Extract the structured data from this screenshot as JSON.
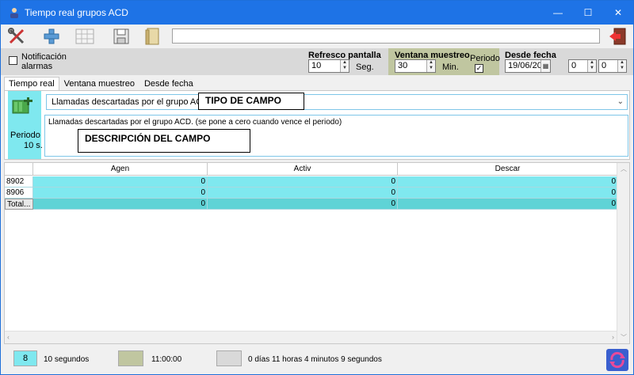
{
  "window": {
    "title": "Tiempo real grupos ACD",
    "minimize_glyph": "—",
    "maximize_glyph": "☐",
    "close_glyph": "✕"
  },
  "toolbar": {
    "buttons": [
      {
        "icon": "tools-icon"
      },
      {
        "icon": "plus-icon"
      },
      {
        "icon": "grid-icon"
      },
      {
        "icon": "save-icon"
      },
      {
        "icon": "book-icon"
      }
    ],
    "search_value": "",
    "exit_icon": "exit-icon"
  },
  "options": {
    "notificacion_label_1": "Notificación",
    "notificacion_label_2": "alarmas",
    "refresco_label": "Refresco pantalla",
    "refresco_value": "10",
    "refresco_unit": "Seg.",
    "ventana_label": "Ventana muestreo",
    "ventana_value": "30",
    "ventana_unit": "Min.",
    "periodo_label": "Periodo",
    "periodo_checked": true,
    "desde_label": "Desde fecha",
    "desde_value": "19/06/20",
    "hour_value": "0",
    "minute_value": "0"
  },
  "tabs": [
    {
      "label": "Tiempo real",
      "active": true
    },
    {
      "label": "Ventana muestreo",
      "active": false
    },
    {
      "label": "Desde fecha",
      "active": false
    }
  ],
  "panel": {
    "periodo_label": "Periodo",
    "periodo_value": "10 s.",
    "combo_value": "Llamadas descartadas por el grupo ACD",
    "description": "Llamadas descartadas por el grupo ACD. (se pone a cero cuando vence el periodo)",
    "callout_tipo": "TIPO DE CAMPO",
    "callout_desc": "DESCRIPCIÓN DEL CAMPO"
  },
  "grid": {
    "columns": [
      "Agen",
      "Activ",
      "Descar"
    ],
    "rows": [
      {
        "label": "8902",
        "values": [
          "0",
          "0",
          "0"
        ]
      },
      {
        "label": "8906",
        "values": [
          "0",
          "0",
          "0"
        ]
      },
      {
        "label": "Total...",
        "values": [
          "0",
          "0",
          "0"
        ],
        "total": true
      }
    ]
  },
  "status": {
    "box1_value": "8",
    "text1": "10 segundos",
    "text2": "11:00:00",
    "text3": "0 días 11 horas 4 minutos 9 segundos",
    "box1_color": "#7fe8ef",
    "box2_color": "#c0c6a0",
    "box3_color": "#d9d9d9"
  }
}
